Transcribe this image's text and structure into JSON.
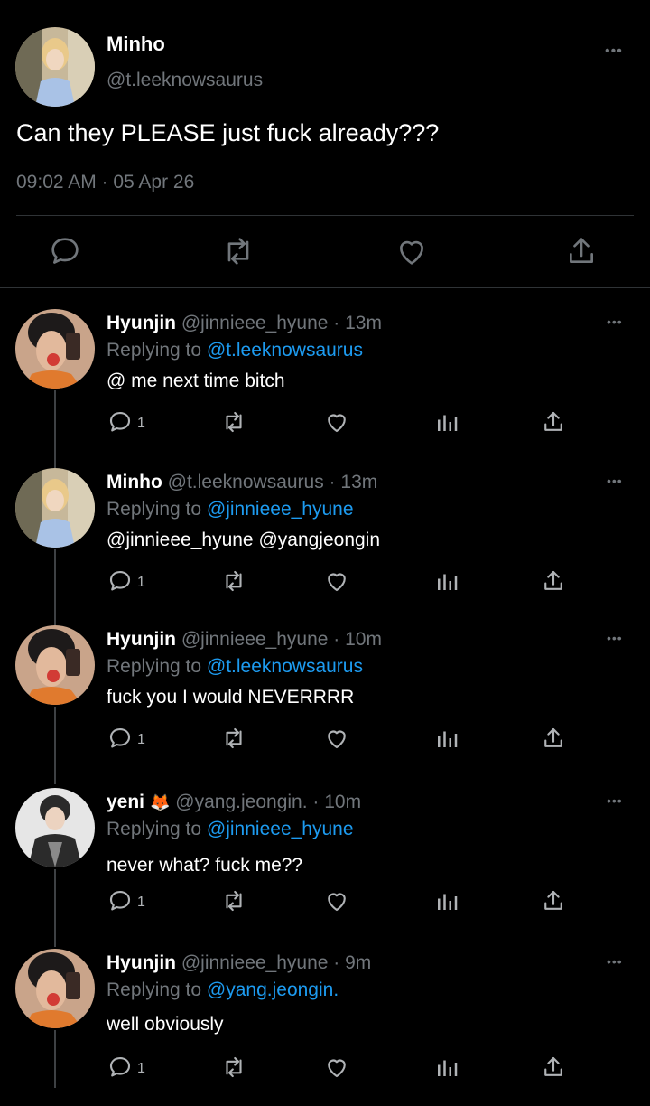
{
  "main_tweet": {
    "author_name": "Minho",
    "author_handle": "@t.leeknowsaurus",
    "text": "Can they PLEASE just fuck already???",
    "timestamp": "09:02 AM · 05 Apr 26",
    "more_label": "•••"
  },
  "replies": [
    {
      "name": "Hyunjin",
      "meta": "@jinnieee_hyune · 13m",
      "replying_prefix": "Replying to ",
      "replying_to": "@t.leeknowsaurus",
      "body": "@ me next time bitch",
      "reply_count": "1",
      "avatar": "hyunjin"
    },
    {
      "name": "Minho",
      "meta": "@t.leeknowsaurus · 13m",
      "replying_prefix": "Replying to ",
      "replying_to": "@jinnieee_hyune",
      "body": "@jinnieee_hyune @yangjeongin",
      "reply_count": "1",
      "avatar": "minho"
    },
    {
      "name": "Hyunjin",
      "meta": "@jinnieee_hyune · 10m",
      "replying_prefix": "Replying to ",
      "replying_to": "@t.leeknowsaurus",
      "body": "fuck you I would NEVERRRR",
      "reply_count": "1",
      "avatar": "hyunjin"
    },
    {
      "name": "yeni",
      "name_emoji": "🦊",
      "meta": "@yang.jeongin. · 10m",
      "replying_prefix": "Replying to ",
      "replying_to": "@jinnieee_hyune",
      "body": "never what? fuck me??",
      "reply_count": "1",
      "avatar": "yeni"
    },
    {
      "name": "Hyunjin",
      "meta": "@jinnieee_hyune · 9m",
      "replying_prefix": "Replying to ",
      "replying_to": "@yang.jeongin.",
      "body": "well obviously",
      "reply_count": "1",
      "avatar": "hyunjin"
    }
  ],
  "icons": [
    "reply-icon",
    "retweet-icon",
    "like-icon",
    "analytics-icon",
    "share-icon",
    "more-icon"
  ],
  "colors": {
    "background": "#000000",
    "text": "#e7e9ea",
    "secondary": "#71767b",
    "link": "#1d9bf0",
    "divider": "#2f3336"
  }
}
